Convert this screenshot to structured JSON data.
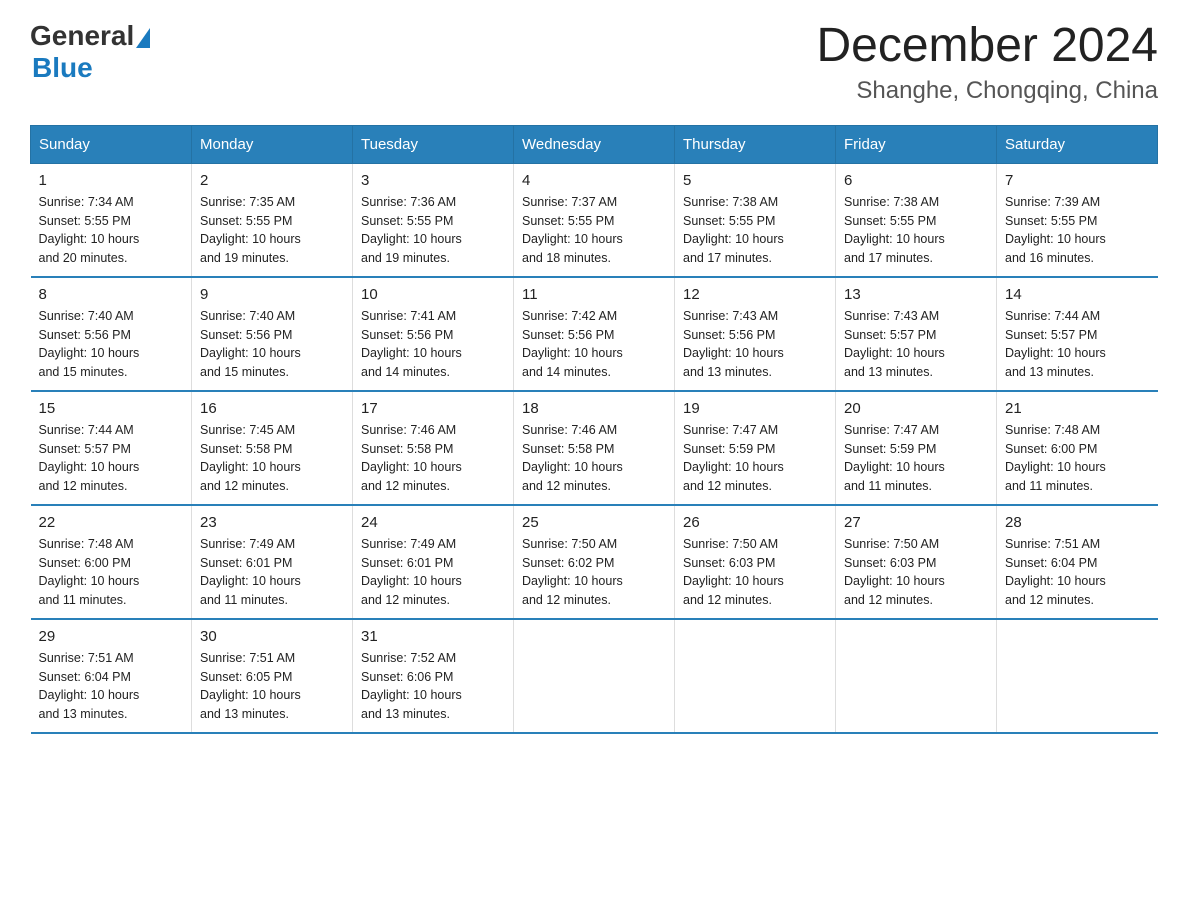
{
  "logo": {
    "general": "General",
    "blue": "Blue"
  },
  "title": "December 2024",
  "subtitle": "Shanghe, Chongqing, China",
  "days_of_week": [
    "Sunday",
    "Monday",
    "Tuesday",
    "Wednesday",
    "Thursday",
    "Friday",
    "Saturday"
  ],
  "weeks": [
    [
      {
        "day": "1",
        "sunrise": "7:34 AM",
        "sunset": "5:55 PM",
        "daylight": "10 hours and 20 minutes."
      },
      {
        "day": "2",
        "sunrise": "7:35 AM",
        "sunset": "5:55 PM",
        "daylight": "10 hours and 19 minutes."
      },
      {
        "day": "3",
        "sunrise": "7:36 AM",
        "sunset": "5:55 PM",
        "daylight": "10 hours and 19 minutes."
      },
      {
        "day": "4",
        "sunrise": "7:37 AM",
        "sunset": "5:55 PM",
        "daylight": "10 hours and 18 minutes."
      },
      {
        "day": "5",
        "sunrise": "7:38 AM",
        "sunset": "5:55 PM",
        "daylight": "10 hours and 17 minutes."
      },
      {
        "day": "6",
        "sunrise": "7:38 AM",
        "sunset": "5:55 PM",
        "daylight": "10 hours and 17 minutes."
      },
      {
        "day": "7",
        "sunrise": "7:39 AM",
        "sunset": "5:55 PM",
        "daylight": "10 hours and 16 minutes."
      }
    ],
    [
      {
        "day": "8",
        "sunrise": "7:40 AM",
        "sunset": "5:56 PM",
        "daylight": "10 hours and 15 minutes."
      },
      {
        "day": "9",
        "sunrise": "7:40 AM",
        "sunset": "5:56 PM",
        "daylight": "10 hours and 15 minutes."
      },
      {
        "day": "10",
        "sunrise": "7:41 AM",
        "sunset": "5:56 PM",
        "daylight": "10 hours and 14 minutes."
      },
      {
        "day": "11",
        "sunrise": "7:42 AM",
        "sunset": "5:56 PM",
        "daylight": "10 hours and 14 minutes."
      },
      {
        "day": "12",
        "sunrise": "7:43 AM",
        "sunset": "5:56 PM",
        "daylight": "10 hours and 13 minutes."
      },
      {
        "day": "13",
        "sunrise": "7:43 AM",
        "sunset": "5:57 PM",
        "daylight": "10 hours and 13 minutes."
      },
      {
        "day": "14",
        "sunrise": "7:44 AM",
        "sunset": "5:57 PM",
        "daylight": "10 hours and 13 minutes."
      }
    ],
    [
      {
        "day": "15",
        "sunrise": "7:44 AM",
        "sunset": "5:57 PM",
        "daylight": "10 hours and 12 minutes."
      },
      {
        "day": "16",
        "sunrise": "7:45 AM",
        "sunset": "5:58 PM",
        "daylight": "10 hours and 12 minutes."
      },
      {
        "day": "17",
        "sunrise": "7:46 AM",
        "sunset": "5:58 PM",
        "daylight": "10 hours and 12 minutes."
      },
      {
        "day": "18",
        "sunrise": "7:46 AM",
        "sunset": "5:58 PM",
        "daylight": "10 hours and 12 minutes."
      },
      {
        "day": "19",
        "sunrise": "7:47 AM",
        "sunset": "5:59 PM",
        "daylight": "10 hours and 12 minutes."
      },
      {
        "day": "20",
        "sunrise": "7:47 AM",
        "sunset": "5:59 PM",
        "daylight": "10 hours and 11 minutes."
      },
      {
        "day": "21",
        "sunrise": "7:48 AM",
        "sunset": "6:00 PM",
        "daylight": "10 hours and 11 minutes."
      }
    ],
    [
      {
        "day": "22",
        "sunrise": "7:48 AM",
        "sunset": "6:00 PM",
        "daylight": "10 hours and 11 minutes."
      },
      {
        "day": "23",
        "sunrise": "7:49 AM",
        "sunset": "6:01 PM",
        "daylight": "10 hours and 11 minutes."
      },
      {
        "day": "24",
        "sunrise": "7:49 AM",
        "sunset": "6:01 PM",
        "daylight": "10 hours and 12 minutes."
      },
      {
        "day": "25",
        "sunrise": "7:50 AM",
        "sunset": "6:02 PM",
        "daylight": "10 hours and 12 minutes."
      },
      {
        "day": "26",
        "sunrise": "7:50 AM",
        "sunset": "6:03 PM",
        "daylight": "10 hours and 12 minutes."
      },
      {
        "day": "27",
        "sunrise": "7:50 AM",
        "sunset": "6:03 PM",
        "daylight": "10 hours and 12 minutes."
      },
      {
        "day": "28",
        "sunrise": "7:51 AM",
        "sunset": "6:04 PM",
        "daylight": "10 hours and 12 minutes."
      }
    ],
    [
      {
        "day": "29",
        "sunrise": "7:51 AM",
        "sunset": "6:04 PM",
        "daylight": "10 hours and 13 minutes."
      },
      {
        "day": "30",
        "sunrise": "7:51 AM",
        "sunset": "6:05 PM",
        "daylight": "10 hours and 13 minutes."
      },
      {
        "day": "31",
        "sunrise": "7:52 AM",
        "sunset": "6:06 PM",
        "daylight": "10 hours and 13 minutes."
      },
      null,
      null,
      null,
      null
    ]
  ],
  "labels": {
    "sunrise": "Sunrise:",
    "sunset": "Sunset:",
    "daylight": "Daylight:"
  }
}
